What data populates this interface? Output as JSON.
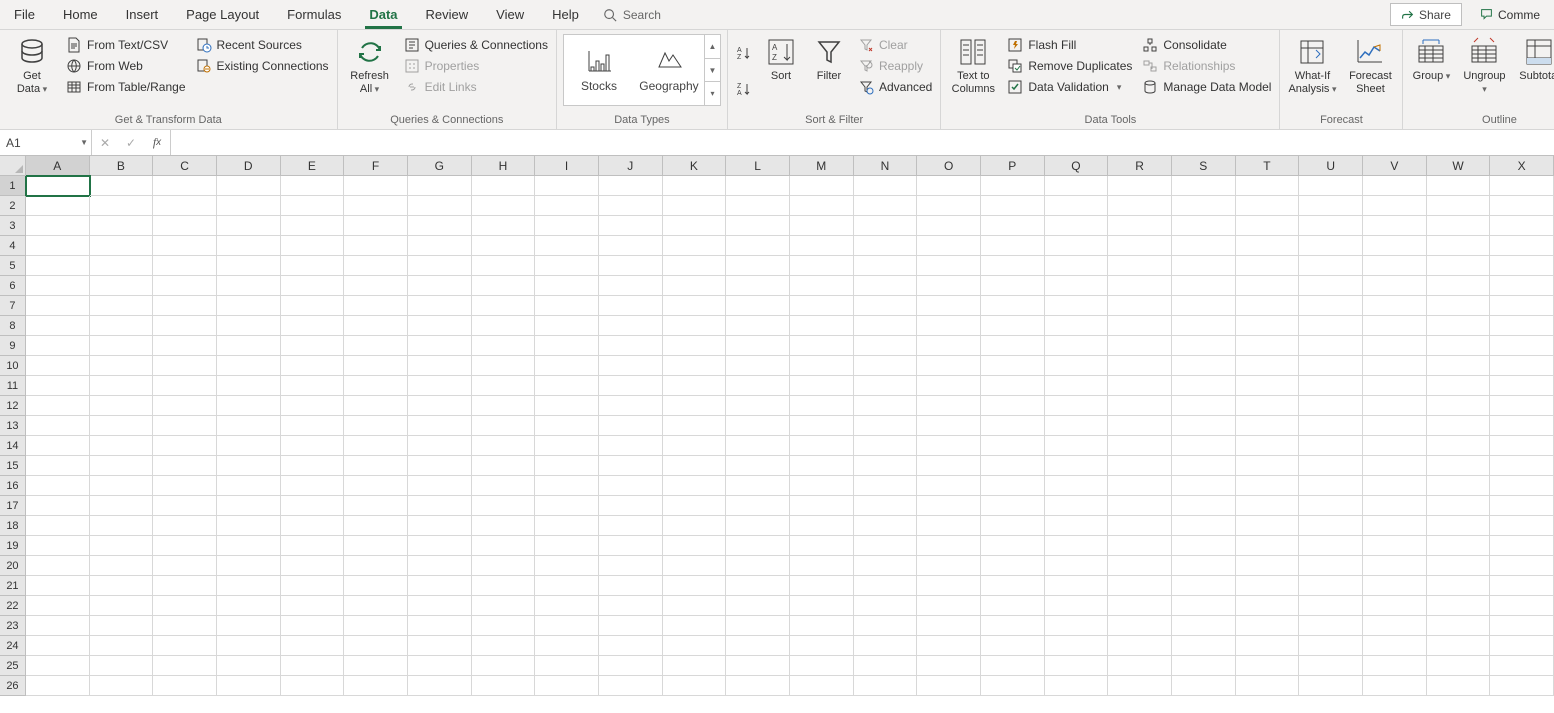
{
  "tabs": [
    "File",
    "Home",
    "Insert",
    "Page Layout",
    "Formulas",
    "Data",
    "Review",
    "View",
    "Help"
  ],
  "active_tab": "Data",
  "search_label": "Search",
  "share_label": "Share",
  "comment_label": "Comme",
  "ribbon": {
    "get_transform": {
      "label": "Get & Transform Data",
      "get_data": "Get\nData",
      "from_text_csv": "From Text/CSV",
      "from_web": "From Web",
      "from_table": "From Table/Range",
      "recent_sources": "Recent Sources",
      "existing_conn": "Existing Connections"
    },
    "queries": {
      "label": "Queries & Connections",
      "refresh_all": "Refresh\nAll",
      "queries_conn": "Queries & Connections",
      "properties": "Properties",
      "edit_links": "Edit Links"
    },
    "data_types": {
      "label": "Data Types",
      "stocks": "Stocks",
      "geography": "Geography"
    },
    "sort_filter": {
      "label": "Sort & Filter",
      "sort": "Sort",
      "filter": "Filter",
      "clear": "Clear",
      "reapply": "Reapply",
      "advanced": "Advanced"
    },
    "data_tools": {
      "label": "Data Tools",
      "text_to_columns": "Text to\nColumns",
      "flash_fill": "Flash Fill",
      "remove_dup": "Remove Duplicates",
      "data_validation": "Data Validation",
      "consolidate": "Consolidate",
      "relationships": "Relationships",
      "manage_model": "Manage Data Model"
    },
    "forecast": {
      "label": "Forecast",
      "what_if": "What-If\nAnalysis",
      "forecast_sheet": "Forecast\nSheet"
    },
    "outline": {
      "label": "Outline",
      "group": "Group",
      "ungroup": "Ungroup",
      "subtotal": "Subtotal"
    }
  },
  "namebox_value": "A1",
  "columns": [
    "A",
    "B",
    "C",
    "D",
    "E",
    "F",
    "G",
    "H",
    "I",
    "J",
    "K",
    "L",
    "M",
    "N",
    "O",
    "P",
    "Q",
    "R",
    "S",
    "T",
    "U",
    "V",
    "W",
    "X"
  ],
  "row_count": 26,
  "active_cell": {
    "row": 1,
    "col": "A"
  }
}
